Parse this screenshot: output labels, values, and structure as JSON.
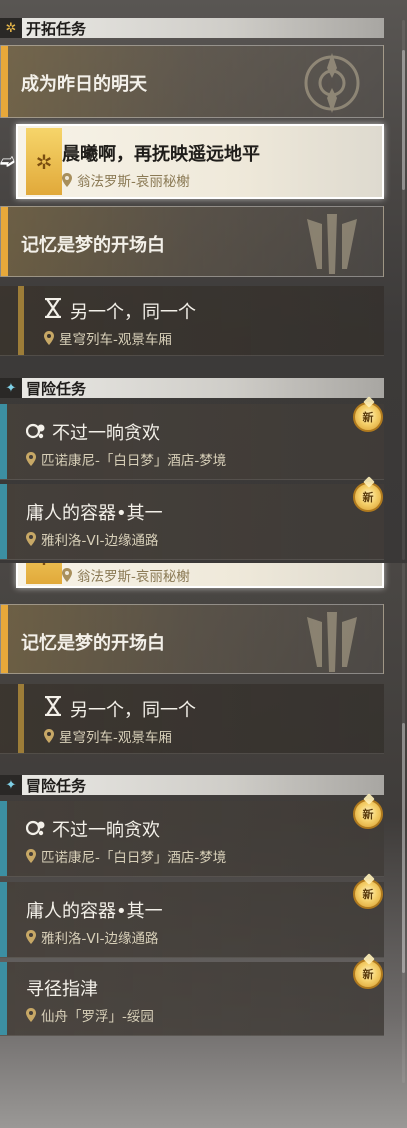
{
  "trailblaze": {
    "header": "开拓任务",
    "main_quest_title": "成为昨日的明天",
    "selected_quest": {
      "title": "晨曦啊，再抚映遥远地平",
      "location": "翁法罗斯-哀丽秘榭"
    },
    "chapter_title": "记忆是梦的开场白",
    "sub_quest": {
      "title": "另一个，同一个",
      "location": "星穹列车-观景车厢"
    }
  },
  "adventure": {
    "header": "冒险任务",
    "new_badge": "新",
    "quests": [
      {
        "title": "不过一晌贪欢",
        "location": "匹诺康尼-「白日梦」酒店-梦境"
      },
      {
        "title": "庸人的容器•其一",
        "location": "雅利洛-VI-边缘通路"
      },
      {
        "title": "寻径指津",
        "location": "仙舟「罗浮」-绥园"
      }
    ]
  },
  "colors": {
    "trailblaze_accent": "#e7a83a",
    "adventure_accent": "#3c8fa2",
    "new_badge": "#f5d06a"
  },
  "icons": {
    "trailblaze_header": "trailblaze-diamond-icon",
    "adventure_header": "adventure-star-icon",
    "location": "location-pin-icon",
    "sub_quest": "hourglass-icon",
    "dream_quest": "bubble-icon"
  }
}
